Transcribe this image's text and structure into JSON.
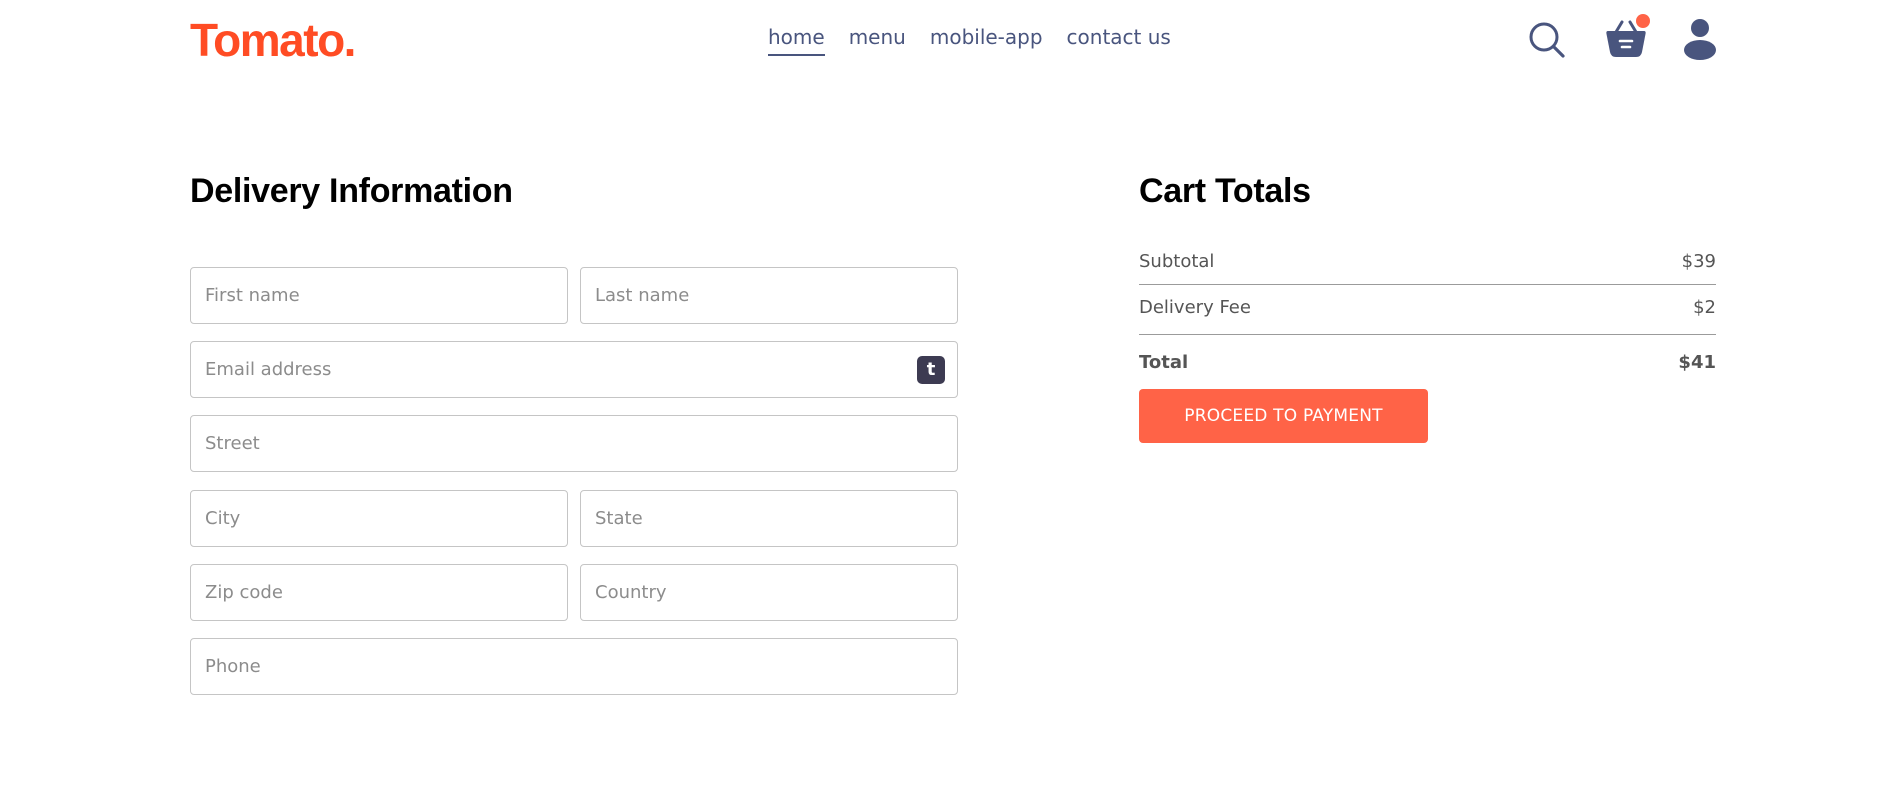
{
  "navbar": {
    "logo": "Tomato.",
    "menu": [
      {
        "label": "home"
      },
      {
        "label": "menu"
      },
      {
        "label": "mobile-app"
      },
      {
        "label": "contact us"
      }
    ],
    "icons": {
      "search": "search-icon",
      "basket": "basket-icon",
      "profile": "profile-icon"
    },
    "accent_color": "#ff4c24",
    "text_color": "#49557e",
    "basket_dot_color": "#ff6347"
  },
  "delivery": {
    "title": "Delivery Information",
    "fields": {
      "first_name": {
        "placeholder": "First name",
        "value": ""
      },
      "last_name": {
        "placeholder": "Last name",
        "value": ""
      },
      "email": {
        "placeholder": "Email address",
        "value": ""
      },
      "street": {
        "placeholder": "Street",
        "value": ""
      },
      "city": {
        "placeholder": "City",
        "value": ""
      },
      "state": {
        "placeholder": "State",
        "value": ""
      },
      "zip": {
        "placeholder": "Zip code",
        "value": ""
      },
      "country": {
        "placeholder": "Country",
        "value": ""
      },
      "phone": {
        "placeholder": "Phone",
        "value": ""
      }
    },
    "email_extension_badge": "t"
  },
  "cart": {
    "title": "Cart Totals",
    "subtotal_label": "Subtotal",
    "subtotal_value": "$39",
    "delivery_fee_label": "Delivery Fee",
    "delivery_fee_value": "$2",
    "total_label": "Total",
    "total_value": "$41",
    "button_label": "PROCEED TO PAYMENT",
    "button_color": "#ff6347"
  }
}
